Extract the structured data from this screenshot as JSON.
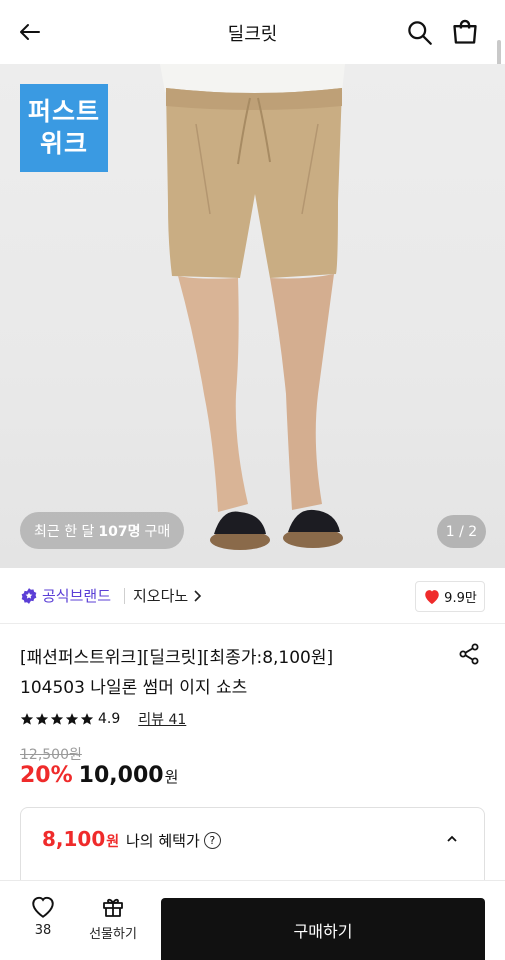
{
  "header": {
    "title": "딜크릿"
  },
  "hero": {
    "badge_line1": "퍼스트",
    "badge_line2": "위크",
    "recent_prefix": "최근 한 달",
    "recent_count": "107명",
    "recent_suffix": "구매",
    "pager": "1 / 2"
  },
  "brand": {
    "official_label": "공식브랜드",
    "name": "지오다노",
    "likes": "9.9만"
  },
  "product": {
    "title_line1": "[패션퍼스트위크][딜크릿][최종가:8,100원]",
    "title_line2": "104503 나일론 썸머 이지 쇼츠",
    "rating": "4.9",
    "review_label": "리뷰 41",
    "original_price": "12,500원",
    "discount": "20%",
    "price": "10,000",
    "won": "원"
  },
  "benefit": {
    "price": "8,100",
    "won": "원",
    "label": "나의 혜택가",
    "help": "?"
  },
  "bottom_bar": {
    "like_count": "38",
    "gift_label": "선물하기",
    "buy_label": "구매하기"
  },
  "colors": {
    "accent_red": "#ef2b2b",
    "badge_blue": "#3a9ae2",
    "official_purple": "#5b3fd6"
  }
}
